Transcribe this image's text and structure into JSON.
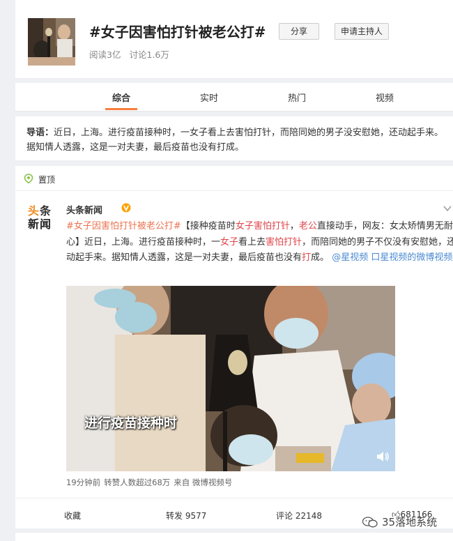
{
  "topic": {
    "title": "#女子因害怕打针被老公打#",
    "reads": "阅读3亿",
    "discussions": "讨论1.6万",
    "share_label": "分享",
    "apply_host_label": "申请主持人"
  },
  "tabs": [
    {
      "label": "综合",
      "active": true
    },
    {
      "label": "实时",
      "active": false
    },
    {
      "label": "热门",
      "active": false
    },
    {
      "label": "视频",
      "active": false
    }
  ],
  "guide": {
    "prefix": "导语：",
    "text": "近日，上海。进行疫苗接种时，一女子看上去害怕打针，而陪同她的男子没安慰她，还动起手来。据知情人透露，这是一对夫妻，最后疫苗也没有打成。"
  },
  "pinned_label": "置顶",
  "post": {
    "logo_line1_a": "头",
    "logo_line1_b": "条",
    "logo_line2": "新闻",
    "author": "头条新闻",
    "text_tag": "#女子因害怕打针被老公打#",
    "text_p1": "【接种疫苗时",
    "text_h1": "女子害怕打针",
    "text_p2": "，",
    "text_h2": "老公",
    "text_p3": "直接动手，网友：女太矫情男无耐心】近日，上海。进行疫苗接种时，一",
    "text_h3": "女子",
    "text_p4": "看上去",
    "text_h4": "害怕打针",
    "text_p5": "，而陪同她的男子不仅没有安慰她，还动起手来。据知情人透露，这是一对夫妻，最后疫苗也没有",
    "text_h5": "打",
    "text_p6": "成。",
    "link1": "@星视频",
    "link2": "口星视频的微博视频",
    "video_caption": "进行疫苗接种时",
    "meta_time": "19分钟前",
    "meta_reposts": "转赞人数超过68万",
    "meta_source": "来自 微博视频号"
  },
  "actions": {
    "favorite": "收藏",
    "repost": "转发 9577",
    "comment": "评论 22148",
    "like": "681166"
  },
  "watermark": "35落地系统",
  "colors": {
    "accent": "#fa7d3c",
    "topic_tag": "#eb7350",
    "highlight": "#e0454a",
    "link": "#4a8ad1"
  }
}
